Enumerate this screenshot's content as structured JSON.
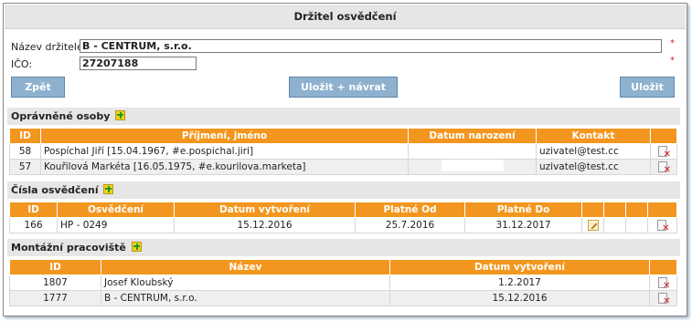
{
  "form": {
    "title": "Držitel osvědčení",
    "holder_name_label": "Název držitele:",
    "holder_name_value": "B - CENTRUM, s.r.o.",
    "ico_label": "IČO:",
    "ico_value": "27207188",
    "required_mark": "*"
  },
  "buttons": {
    "back": "Zpět",
    "save_return": "Uložit + návrat",
    "save": "Uložit"
  },
  "persons": {
    "section_title": "Oprávněné osoby",
    "headers": [
      "ID",
      "Příjmení, jméno",
      "Datum narození",
      "Kontakt"
    ],
    "rows": [
      {
        "id": "58",
        "name": "Pospíchal Jiří [15.04.1967, #e.pospichal.jiri]",
        "contact": "uzivatel@test.cc"
      },
      {
        "id": "57",
        "name": "Kouřilová Markéta [16.05.1975, #e.kourilova.marketa]",
        "contact": "uzivatel@test.cc"
      }
    ]
  },
  "certificates": {
    "section_title": "Čísla osvědčení",
    "headers": [
      "ID",
      "Osvědčení",
      "Datum vytvoření",
      "Platné Od",
      "Platné Do"
    ],
    "rows": [
      {
        "id": "166",
        "cert": "HP - 0249",
        "created": "15.12.2016",
        "from": "25.7.2016",
        "to": "31.12.2017"
      }
    ]
  },
  "workplaces": {
    "section_title": "Montážní pracoviště",
    "headers": [
      "ID",
      "Název",
      "Datum vytvoření"
    ],
    "rows": [
      {
        "id": "1807",
        "name": "Josef Kloubský",
        "created": "1.2.2017"
      },
      {
        "id": "1777",
        "name": "B - CENTRUM, s.r.o.",
        "created": "15.12.2016"
      }
    ]
  },
  "icons": {
    "add": "add-icon",
    "delete": "delete-icon",
    "edit": "edit-icon"
  },
  "colors": {
    "header": "#f3961f",
    "button": "#8eb1cf",
    "section": "#e6e6e6"
  }
}
